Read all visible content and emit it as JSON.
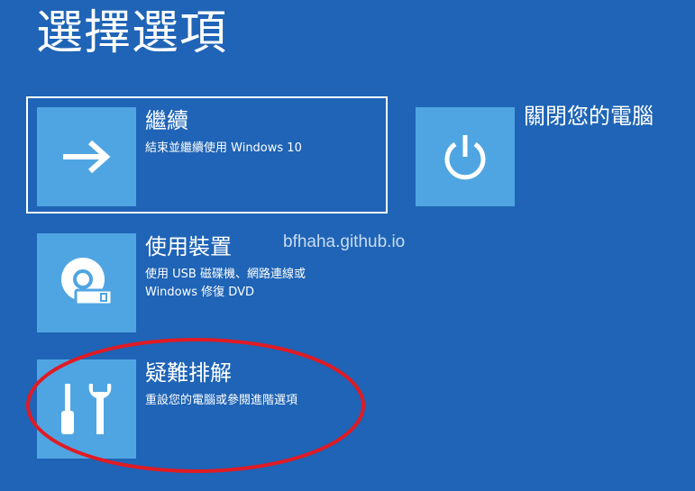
{
  "page": {
    "title": "選擇選項",
    "watermark": "bfhaha.github.io"
  },
  "options": {
    "continue": {
      "title": "繼續",
      "description": "結束並繼續使用 Windows 10",
      "icon": "arrow-right-icon",
      "selected": true
    },
    "shutdown": {
      "title": "關閉您的電腦",
      "icon": "power-icon"
    },
    "use_device": {
      "title": "使用裝置",
      "description": "使用 USB 磁碟機、網路連線或\nWindows 修復 DVD",
      "icon": "disc-drive-icon"
    },
    "troubleshoot": {
      "title": "疑難排解",
      "description": "重設您的電腦或參閱進階選項",
      "icon": "tools-icon"
    }
  },
  "colors": {
    "background": "#1f64b6",
    "tile": "#4fa5e2",
    "annotation": "#e01b24"
  }
}
